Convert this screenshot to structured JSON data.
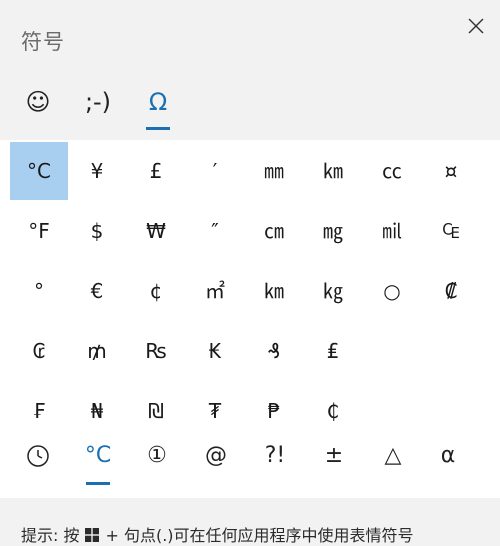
{
  "window": {
    "title": "符号"
  },
  "categories": [
    {
      "label": "☺",
      "icon": "smiley-icon"
    },
    {
      "label": ";-)",
      "icon": "kaomoji-icon"
    },
    {
      "label": "Ω",
      "icon": "omega-icon",
      "active": true
    }
  ],
  "symbols": [
    [
      "°C",
      "¥",
      "£",
      "′",
      "㎜",
      "㎞",
      "㏄",
      "¤"
    ],
    [
      "°F",
      "$",
      "₩",
      "″",
      "㎝",
      "㎎",
      "㏕",
      "₠"
    ],
    [
      "°",
      "€",
      "¢",
      "㎡",
      "㎞",
      "㎏",
      "○",
      "₡"
    ],
    [
      "₢",
      "₥",
      "₨",
      "₭",
      "₰",
      "₤"
    ],
    [
      "₣",
      "₦",
      "₪",
      "₮",
      "₱",
      "₵"
    ]
  ],
  "subcategories": [
    {
      "label": "🕒",
      "icon": "clock-icon"
    },
    {
      "label": "°C",
      "active": true
    },
    {
      "label": "①"
    },
    {
      "label": "@"
    },
    {
      "label": "?!"
    },
    {
      "label": "±"
    },
    {
      "label": "△"
    },
    {
      "label": "α"
    }
  ],
  "footer": {
    "hint_prefix": "提示: 按",
    "hint_suffix": "+ 句点(.)可在任何应用程序中使用表情符号"
  },
  "accent_color": "#1a6fb5",
  "selected_color": "#a8cff0"
}
